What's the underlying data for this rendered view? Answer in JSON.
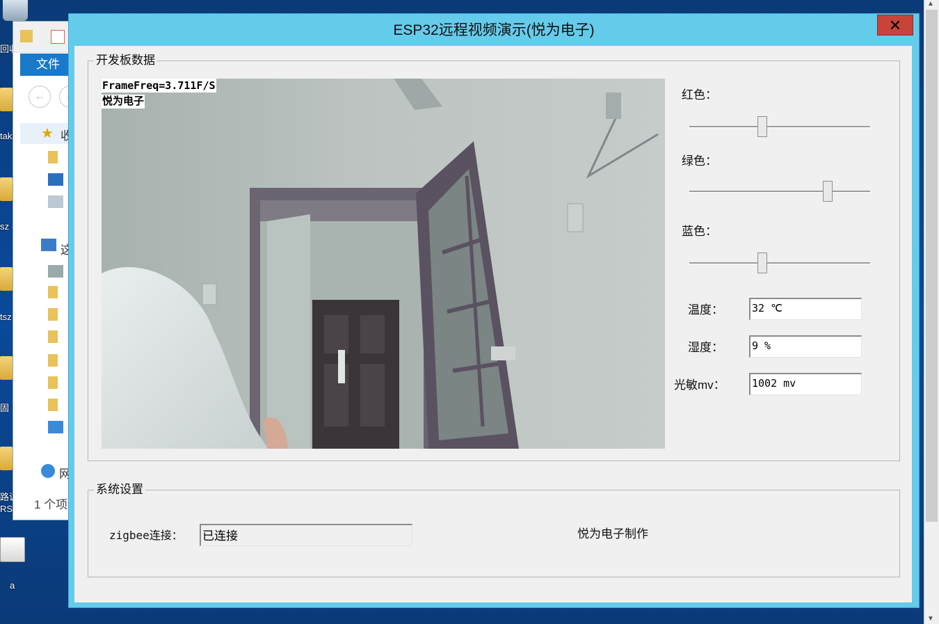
{
  "desktop": {
    "labels": [
      "回收",
      "tak",
      "sz",
      "tsz",
      "固",
      "路调",
      "RS",
      "a"
    ]
  },
  "explorer": {
    "tab_label": "文件",
    "nav_back": "←",
    "nav_forward": "→",
    "favorites_label": "收",
    "this_pc_label": "这",
    "network_label": "网",
    "item_count": "1 个项"
  },
  "app": {
    "title": "ESP32远程视频演示(悦为电子)",
    "close_label": "✕",
    "board_group": {
      "title": "开发板数据",
      "video": {
        "frame_freq": "FrameFreq=3.711F/S",
        "brand_overlay": "悦为电子"
      },
      "sliders": [
        {
          "label": "红色：",
          "value": 0.4
        },
        {
          "label": "绿色：",
          "value": 0.78
        },
        {
          "label": "蓝色：",
          "value": 0.4
        }
      ],
      "readings": {
        "temperature": {
          "label": "温度：",
          "value": "32 ℃"
        },
        "humidity": {
          "label": "湿度：",
          "value": "9 %"
        },
        "light": {
          "label": "光敏mv：",
          "value": "1002 mv"
        }
      }
    },
    "system_group": {
      "title": "系统设置",
      "zigbee_label": "zigbee连接：",
      "zigbee_status": "已连接",
      "credit": "悦为电子制作"
    }
  },
  "colors": {
    "title_bar": "#65cbeb",
    "close_button": "#c8443a",
    "desktop": "#0a4a9a"
  }
}
